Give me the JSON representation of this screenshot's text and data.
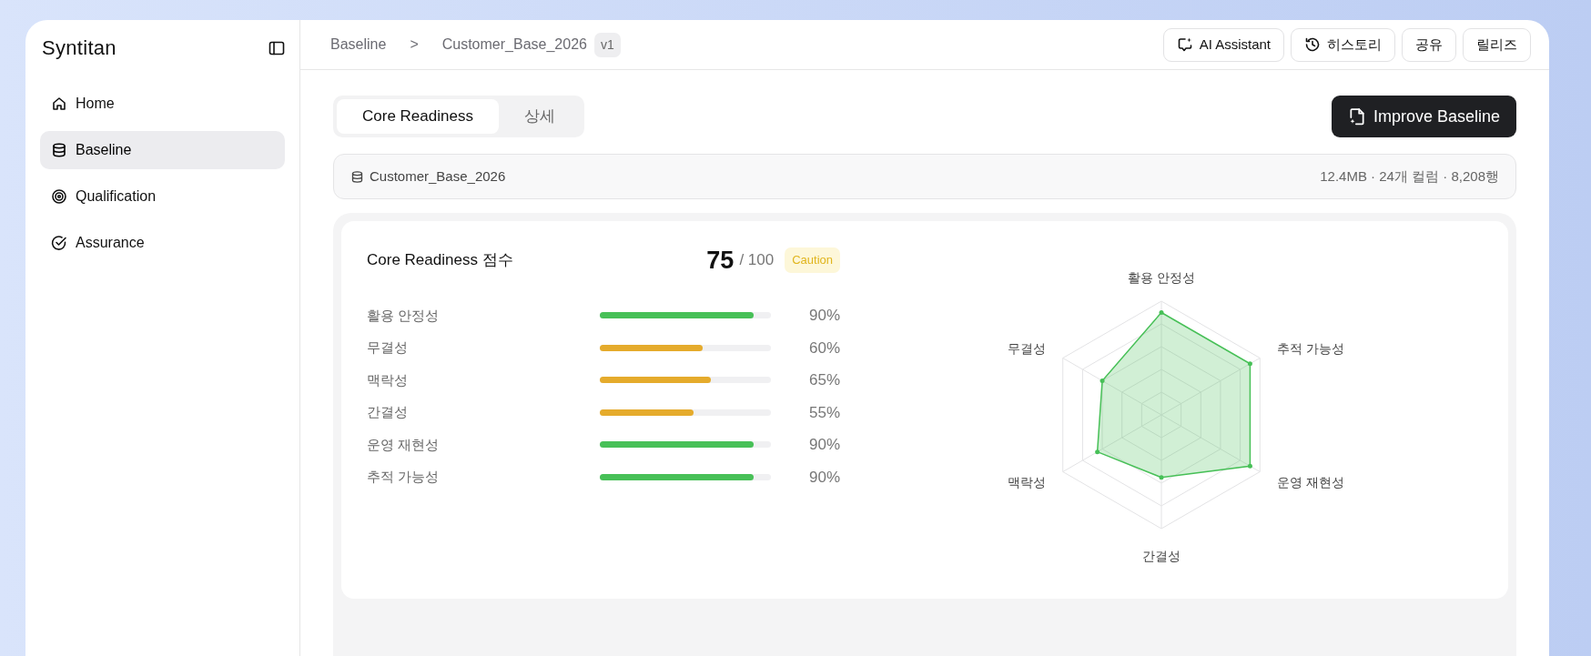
{
  "sidebar": {
    "logo": "Syntitan",
    "items": [
      {
        "label": "Home",
        "selected": false
      },
      {
        "label": "Baseline",
        "selected": true
      },
      {
        "label": "Qualification",
        "selected": false
      },
      {
        "label": "Assurance",
        "selected": false
      }
    ]
  },
  "header": {
    "breadcrumb": [
      "Baseline",
      "Customer_Base_2026"
    ],
    "separator": ">",
    "version": "v1",
    "buttons": [
      {
        "label": "AI Assistant"
      },
      {
        "label": "히스토리"
      },
      {
        "label": "공유"
      },
      {
        "label": "릴리즈"
      }
    ]
  },
  "tabs": [
    {
      "label": "Core Readiness",
      "selected": true
    },
    {
      "label": "상세",
      "selected": false
    }
  ],
  "primary_button": "Improve Baseline",
  "dataset": {
    "name": "Customer_Base_2026",
    "meta": "12.4MB · 24개 컬럼 · 8,208행"
  },
  "score": {
    "title": "Core Readiness 점수",
    "value": "75",
    "max": "/ 100",
    "status": "Caution",
    "metrics": [
      {
        "label": "활용 안정성",
        "level": 0.9,
        "reading": "90%",
        "color": "#47c057"
      },
      {
        "label": "무결성",
        "level": 0.6,
        "reading": "60%",
        "color": "#e5ab2c"
      },
      {
        "label": "맥락성",
        "level": 0.65,
        "reading": "65%",
        "color": "#e5ab2c"
      },
      {
        "label": "간결성",
        "level": 0.55,
        "reading": "55%",
        "color": "#e5ab2c"
      },
      {
        "label": "운영 재현성",
        "level": 0.9,
        "reading": "90%",
        "color": "#47c057"
      },
      {
        "label": "추적 가능성",
        "level": 0.9,
        "reading": "90%",
        "color": "#47c057"
      }
    ]
  },
  "radar": {
    "axes": [
      {
        "label": "활용 안정성"
      },
      {
        "label": "추적 가능성"
      },
      {
        "label": "운영 재현성"
      },
      {
        "label": "간결성"
      },
      {
        "label": "맥락성"
      },
      {
        "label": "무결성"
      }
    ]
  }
}
